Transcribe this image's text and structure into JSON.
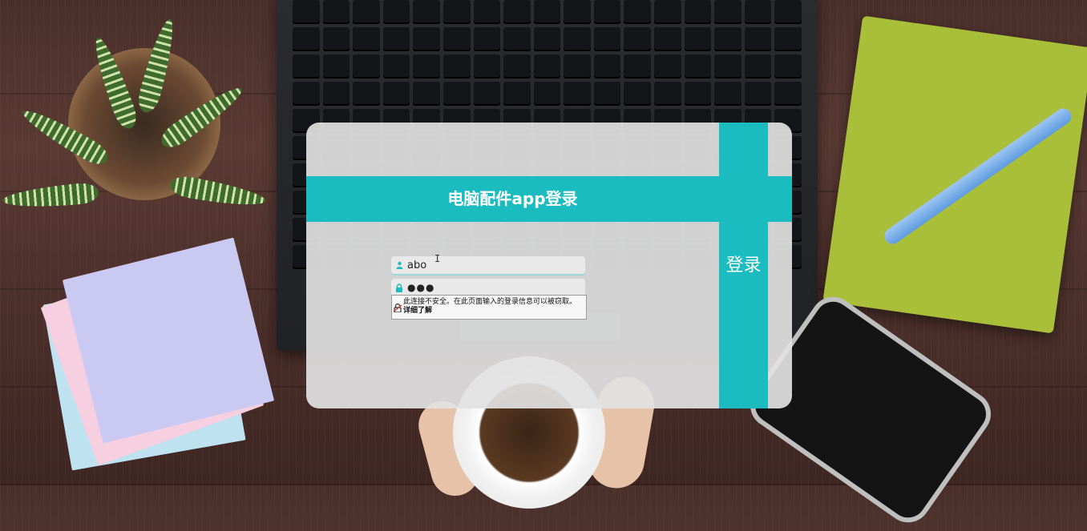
{
  "dialog": {
    "title": "电脑配件app登录",
    "login_label": "登录"
  },
  "form": {
    "username": {
      "value": "abo",
      "icon": "user-icon"
    },
    "password": {
      "value": "●●●",
      "icon": "lock-icon"
    }
  },
  "security_warning": {
    "text": "此连接不安全。在此页面输入的登录信息可以被窃取。",
    "link": "详细了解",
    "icon": "broken-lock-icon"
  },
  "colors": {
    "accent": "#1bbcbf",
    "panel": "#e2e2e2"
  }
}
